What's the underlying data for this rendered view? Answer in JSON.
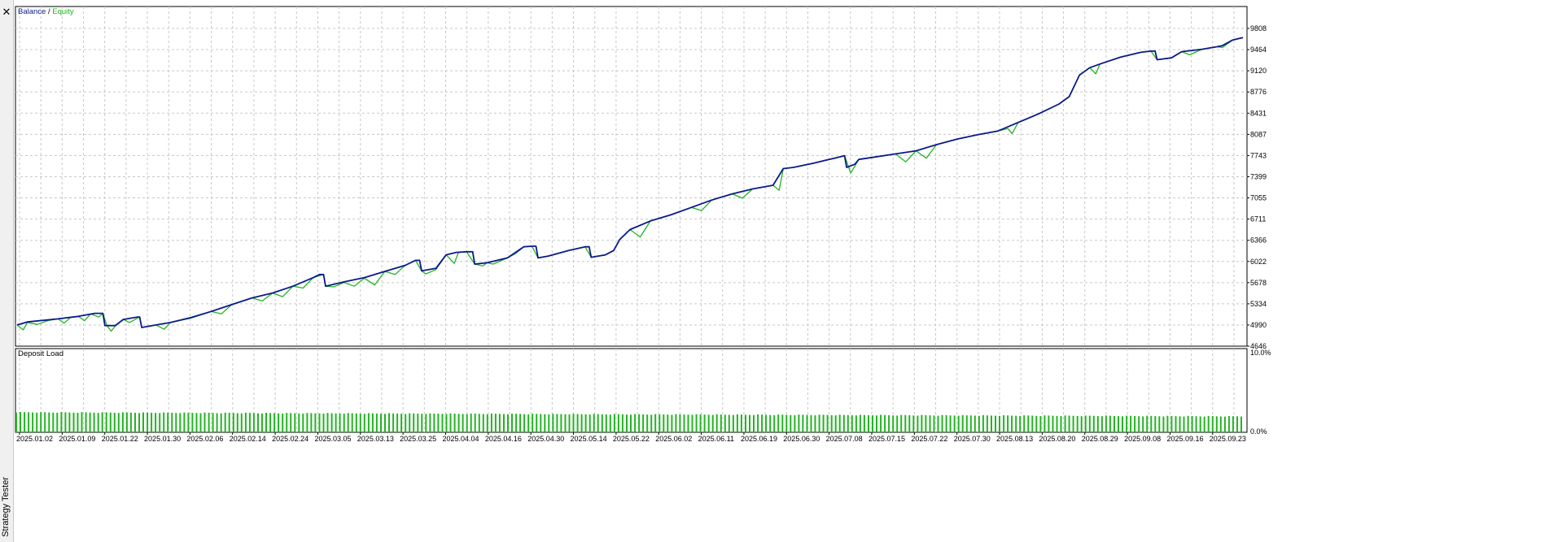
{
  "window": {
    "close_label": "✕",
    "sidebar_title": "Strategy Tester"
  },
  "colors": {
    "balance": "#0b1a8c",
    "equity": "#22b422",
    "deposit_load": "#22b422",
    "grid": "#c8c8c8",
    "frame": "#000000"
  },
  "chart_data": [
    {
      "type": "line",
      "title": "",
      "legend": {
        "items": [
          "Balance",
          "Equity"
        ],
        "separator": " / ",
        "placement": "top-left"
      },
      "y_ticks": [
        4646,
        4990,
        5334,
        5678,
        6022,
        6366,
        6711,
        7055,
        7399,
        7743,
        8087,
        8431,
        8776,
        9120,
        9464,
        9808
      ],
      "ylim": [
        4646,
        9808
      ],
      "x_ticks": [
        "2025.01.02",
        "2025.01.09",
        "2025.01.22",
        "2025.01.30",
        "2025.02.06",
        "2025.02.14",
        "2025.02.24",
        "2025.03.05",
        "2025.03.13",
        "2025.03.25",
        "2025.04.04",
        "2025.04.16",
        "2025.04.30",
        "2025.05.14",
        "2025.05.22",
        "2025.06.02",
        "2025.06.11",
        "2025.06.19",
        "2025.06.30",
        "2025.07.08",
        "2025.07.15",
        "2025.07.22",
        "2025.07.30",
        "2025.08.13",
        "2025.08.20",
        "2025.08.29",
        "2025.09.08",
        "2025.09.16",
        "2025.09.23"
      ],
      "grid": true,
      "series": [
        {
          "name": "Balance",
          "points": [
            [
              0,
              4990
            ],
            [
              0.5,
              5040
            ],
            [
              2.0,
              5090
            ],
            [
              3.0,
              5130
            ],
            [
              3.8,
              5180
            ],
            [
              4.2,
              5180
            ],
            [
              4.3,
              4980
            ],
            [
              4.8,
              4980
            ],
            [
              5.2,
              5080
            ],
            [
              5.9,
              5120
            ],
            [
              6.0,
              5120
            ],
            [
              6.1,
              4950
            ],
            [
              6.8,
              4990
            ],
            [
              7.5,
              5030
            ],
            [
              8.5,
              5110
            ],
            [
              9.5,
              5210
            ],
            [
              10.5,
              5320
            ],
            [
              11.5,
              5430
            ],
            [
              12.5,
              5510
            ],
            [
              13.5,
              5620
            ],
            [
              14.5,
              5760
            ],
            [
              14.8,
              5810
            ],
            [
              15.0,
              5810
            ],
            [
              15.1,
              5620
            ],
            [
              16.0,
              5690
            ],
            [
              17.0,
              5760
            ],
            [
              18.0,
              5860
            ],
            [
              19.0,
              5960
            ],
            [
              19.5,
              6040
            ],
            [
              19.7,
              6040
            ],
            [
              19.8,
              5870
            ],
            [
              20.5,
              5910
            ],
            [
              21.0,
              6130
            ],
            [
              21.5,
              6170
            ],
            [
              22.0,
              6180
            ],
            [
              22.3,
              6180
            ],
            [
              22.4,
              5980
            ],
            [
              23.0,
              6000
            ],
            [
              24.0,
              6080
            ],
            [
              24.8,
              6260
            ],
            [
              25.2,
              6270
            ],
            [
              25.4,
              6270
            ],
            [
              25.5,
              6080
            ],
            [
              26.0,
              6110
            ],
            [
              27.0,
              6200
            ],
            [
              27.8,
              6260
            ],
            [
              28.0,
              6260
            ],
            [
              28.1,
              6090
            ],
            [
              28.8,
              6130
            ],
            [
              29.2,
              6200
            ],
            [
              29.5,
              6380
            ],
            [
              30.0,
              6540
            ],
            [
              31.0,
              6680
            ],
            [
              32.0,
              6780
            ],
            [
              33.0,
              6900
            ],
            [
              34.0,
              7020
            ],
            [
              35.0,
              7120
            ],
            [
              36.0,
              7200
            ],
            [
              37.0,
              7260
            ],
            [
              37.5,
              7530
            ],
            [
              38.0,
              7550
            ],
            [
              39.0,
              7620
            ],
            [
              40.0,
              7700
            ],
            [
              40.5,
              7740
            ],
            [
              40.6,
              7550
            ],
            [
              41.0,
              7600
            ],
            [
              41.2,
              7680
            ],
            [
              42.0,
              7720
            ],
            [
              43.0,
              7770
            ],
            [
              44.0,
              7820
            ],
            [
              45.0,
              7920
            ],
            [
              46.0,
              8010
            ],
            [
              47.0,
              8080
            ],
            [
              48.0,
              8140
            ],
            [
              49.0,
              8280
            ],
            [
              50.0,
              8420
            ],
            [
              51.0,
              8580
            ],
            [
              51.5,
              8700
            ],
            [
              52.0,
              9050
            ],
            [
              52.5,
              9170
            ],
            [
              53.0,
              9230
            ],
            [
              54.0,
              9340
            ],
            [
              55.0,
              9420
            ],
            [
              55.5,
              9440
            ],
            [
              55.7,
              9440
            ],
            [
              55.8,
              9300
            ],
            [
              56.5,
              9330
            ],
            [
              57.0,
              9430
            ],
            [
              58.0,
              9470
            ],
            [
              58.7,
              9510
            ],
            [
              59.0,
              9530
            ],
            [
              59.5,
              9620
            ],
            [
              60.0,
              9660
            ]
          ]
        },
        {
          "name": "Equity",
          "points": [
            [
              0,
              4990
            ],
            [
              0.3,
              4910
            ],
            [
              0.5,
              5030
            ],
            [
              1.0,
              5000
            ],
            [
              1.5,
              5060
            ],
            [
              2.0,
              5090
            ],
            [
              2.3,
              5020
            ],
            [
              2.6,
              5110
            ],
            [
              3.0,
              5130
            ],
            [
              3.3,
              5060
            ],
            [
              3.6,
              5170
            ],
            [
              4.0,
              5120
            ],
            [
              4.2,
              5180
            ],
            [
              4.4,
              4980
            ],
            [
              4.6,
              4890
            ],
            [
              4.8,
              4970
            ],
            [
              5.2,
              5080
            ],
            [
              5.5,
              5030
            ],
            [
              6.0,
              5120
            ],
            [
              6.1,
              4950
            ],
            [
              6.5,
              4970
            ],
            [
              6.8,
              4990
            ],
            [
              7.2,
              4920
            ],
            [
              7.5,
              5030
            ],
            [
              8.5,
              5100
            ],
            [
              9.5,
              5210
            ],
            [
              10.0,
              5170
            ],
            [
              10.5,
              5320
            ],
            [
              11.5,
              5430
            ],
            [
              12.0,
              5380
            ],
            [
              12.5,
              5510
            ],
            [
              13.0,
              5450
            ],
            [
              13.5,
              5620
            ],
            [
              14.0,
              5590
            ],
            [
              14.5,
              5760
            ],
            [
              15.0,
              5810
            ],
            [
              15.1,
              5620
            ],
            [
              15.5,
              5610
            ],
            [
              16.0,
              5680
            ],
            [
              16.5,
              5620
            ],
            [
              17.0,
              5750
            ],
            [
              17.5,
              5640
            ],
            [
              18.0,
              5860
            ],
            [
              18.5,
              5810
            ],
            [
              19.0,
              5960
            ],
            [
              19.5,
              6040
            ],
            [
              19.8,
              5870
            ],
            [
              20.0,
              5820
            ],
            [
              20.5,
              5890
            ],
            [
              21.0,
              6130
            ],
            [
              21.4,
              5990
            ],
            [
              21.6,
              6170
            ],
            [
              22.0,
              6180
            ],
            [
              22.4,
              5980
            ],
            [
              22.8,
              5950
            ],
            [
              23.0,
              6000
            ],
            [
              23.3,
              5980
            ],
            [
              24.0,
              6080
            ],
            [
              24.4,
              6150
            ],
            [
              24.8,
              6260
            ],
            [
              25.2,
              6270
            ],
            [
              25.5,
              6080
            ],
            [
              26.0,
              6110
            ],
            [
              27.0,
              6200
            ],
            [
              27.8,
              6260
            ],
            [
              28.1,
              6090
            ],
            [
              28.8,
              6130
            ],
            [
              29.2,
              6200
            ],
            [
              29.5,
              6380
            ],
            [
              30.0,
              6540
            ],
            [
              30.5,
              6420
            ],
            [
              31.0,
              6680
            ],
            [
              32.0,
              6780
            ],
            [
              33.0,
              6900
            ],
            [
              33.5,
              6850
            ],
            [
              34.0,
              7020
            ],
            [
              35.0,
              7120
            ],
            [
              35.5,
              7050
            ],
            [
              36.0,
              7200
            ],
            [
              37.0,
              7260
            ],
            [
              37.3,
              7180
            ],
            [
              37.5,
              7530
            ],
            [
              38.0,
              7550
            ],
            [
              39.0,
              7620
            ],
            [
              40.0,
              7700
            ],
            [
              40.5,
              7740
            ],
            [
              40.8,
              7460
            ],
            [
              41.2,
              7680
            ],
            [
              42.0,
              7720
            ],
            [
              43.0,
              7770
            ],
            [
              43.5,
              7640
            ],
            [
              44.0,
              7820
            ],
            [
              44.5,
              7700
            ],
            [
              45.0,
              7920
            ],
            [
              46.0,
              8010
            ],
            [
              47.0,
              8080
            ],
            [
              48.0,
              8140
            ],
            [
              48.5,
              8180
            ],
            [
              48.7,
              8100
            ],
            [
              49.0,
              8280
            ],
            [
              50.0,
              8420
            ],
            [
              51.0,
              8580
            ],
            [
              51.5,
              8700
            ],
            [
              52.0,
              9050
            ],
            [
              52.5,
              9170
            ],
            [
              52.8,
              9070
            ],
            [
              53.0,
              9230
            ],
            [
              54.0,
              9340
            ],
            [
              55.0,
              9420
            ],
            [
              55.5,
              9440
            ],
            [
              55.8,
              9300
            ],
            [
              56.5,
              9330
            ],
            [
              57.0,
              9430
            ],
            [
              57.4,
              9380
            ],
            [
              58.0,
              9470
            ],
            [
              58.7,
              9510
            ],
            [
              59.0,
              9500
            ],
            [
              59.5,
              9620
            ],
            [
              60.0,
              9660
            ]
          ]
        }
      ]
    },
    {
      "type": "bar",
      "title": "Deposit Load",
      "y_ticks": [
        "10.0%",
        "0.0%"
      ],
      "ylim": [
        0,
        10
      ],
      "bar_count": 300,
      "bar_value_range": [
        1.9,
        2.4
      ]
    }
  ]
}
